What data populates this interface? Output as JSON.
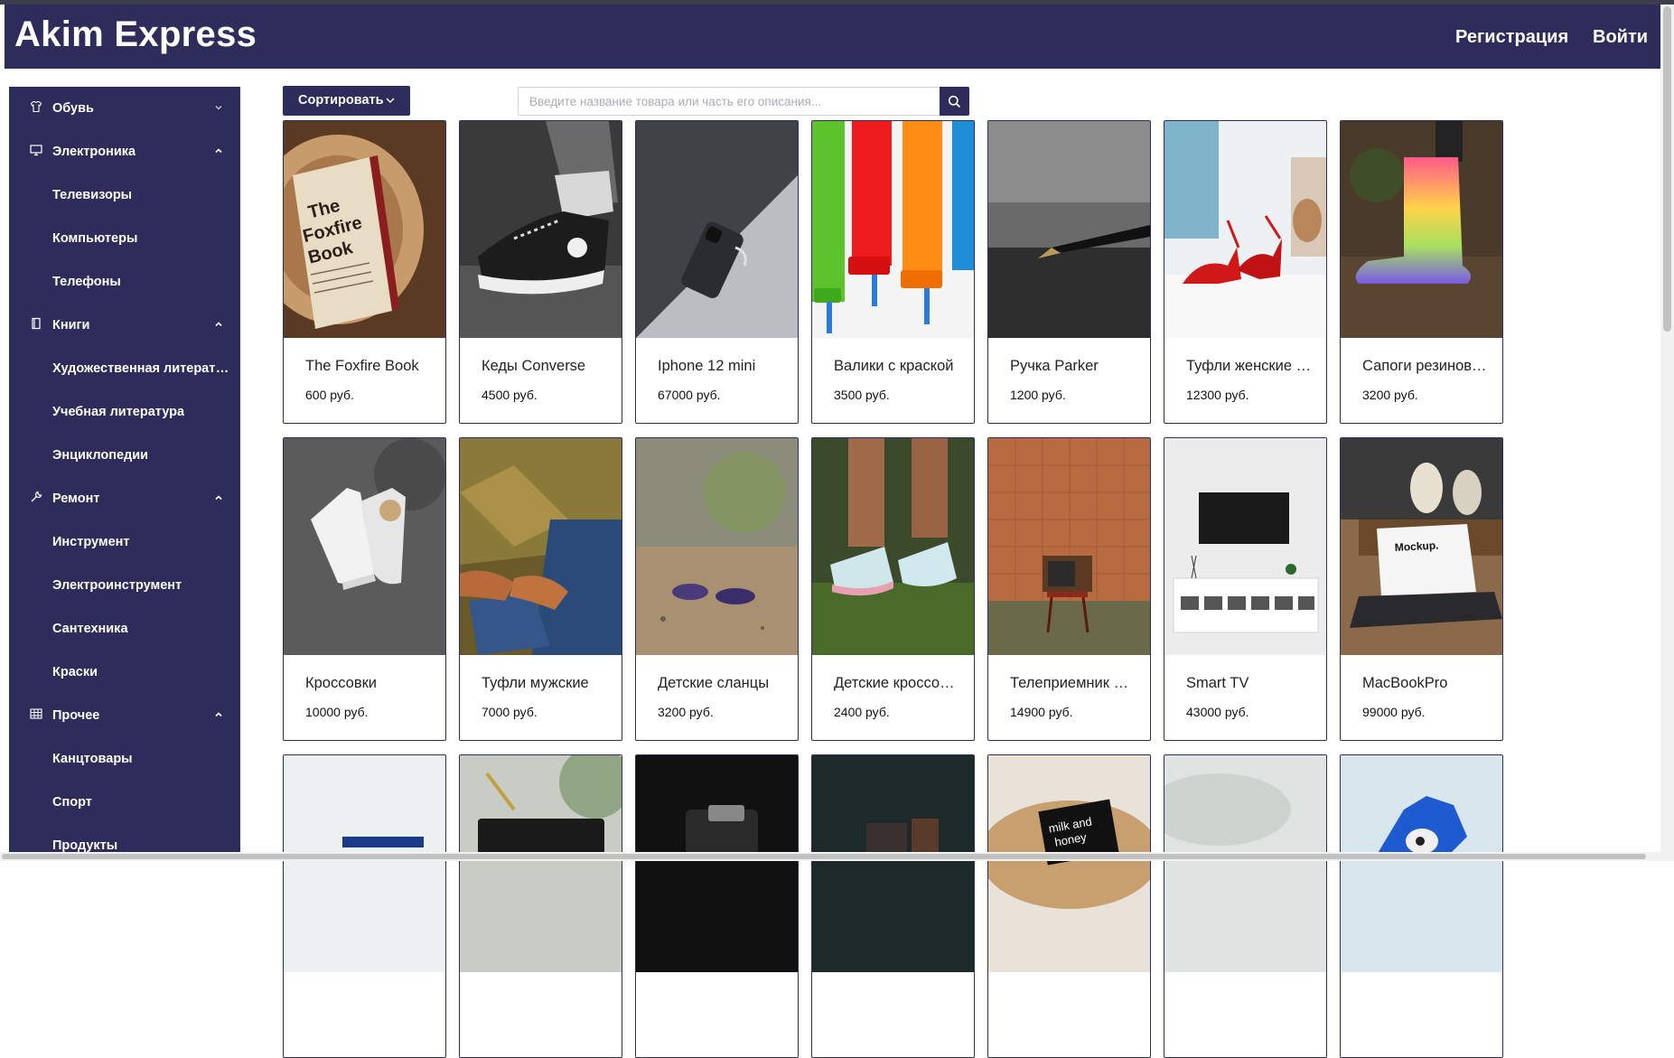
{
  "header": {
    "logo": "Akim Express",
    "register": "Регистрация",
    "login": "Войти"
  },
  "sidebar": {
    "items": [
      {
        "label": "Обувь",
        "icon": "shirt-icon",
        "level": 0,
        "chevron": "down"
      },
      {
        "label": "Электроника",
        "icon": "monitor-icon",
        "level": 0,
        "chevron": "up"
      },
      {
        "label": "Телевизоры",
        "level": 1
      },
      {
        "label": "Компьютеры",
        "level": 1
      },
      {
        "label": "Телефоны",
        "level": 1
      },
      {
        "label": "Книги",
        "icon": "book-icon",
        "level": 0,
        "chevron": "up"
      },
      {
        "label": "Художественная литература",
        "level": 1
      },
      {
        "label": "Учебная литература",
        "level": 1
      },
      {
        "label": "Энциклопедии",
        "level": 1
      },
      {
        "label": "Ремонт",
        "icon": "wrench-icon",
        "level": 0,
        "chevron": "up"
      },
      {
        "label": "Инструмент",
        "level": 1
      },
      {
        "label": "Электроинструмент",
        "level": 1
      },
      {
        "label": "Сантехника",
        "level": 1
      },
      {
        "label": "Краски",
        "level": 1
      },
      {
        "label": "Прочее",
        "icon": "table-icon",
        "level": 0,
        "chevron": "up"
      },
      {
        "label": "Канцтовары",
        "level": 1
      },
      {
        "label": "Спорт",
        "level": 1
      },
      {
        "label": "Продукты",
        "level": 1
      }
    ]
  },
  "toolbar": {
    "sort_label": "Сортировать",
    "search_placeholder": "Введите название товара или часть его описания..."
  },
  "colors": {
    "brand": "#2d2c5a",
    "background": "#ffffff",
    "card_border": "#2d2c5a"
  },
  "products": [
    {
      "name": "The Foxfire Book",
      "price": "600 руб.",
      "image": "foxfire-book-photo"
    },
    {
      "name": "Кеды Converse",
      "price": "4500 руб.",
      "image": "converse-sneaker-photo"
    },
    {
      "name": "Iphone 12 mini",
      "price": "67000 руб.",
      "image": "iphone-photo"
    },
    {
      "name": "Валики с краской",
      "price": "3500 руб.",
      "image": "paint-rollers-photo"
    },
    {
      "name": "Ручка Parker",
      "price": "1200 руб.",
      "image": "pen-photo"
    },
    {
      "name": "Туфли женские красные",
      "price": "12300 руб.",
      "image": "red-heels-photo"
    },
    {
      "name": "Сапоги резиновые",
      "price": "3200 руб.",
      "image": "rain-boots-photo"
    },
    {
      "name": "Кроссовки",
      "price": "10000 руб.",
      "image": "white-sneakers-photo"
    },
    {
      "name": "Туфли мужские",
      "price": "7000 руб.",
      "image": "mens-shoes-photo"
    },
    {
      "name": "Детские сланцы",
      "price": "3200 руб.",
      "image": "kids-slippers-photo"
    },
    {
      "name": "Детские кроссовки",
      "price": "2400 руб.",
      "image": "kids-sneakers-photo"
    },
    {
      "name": "Телеприемник ретро",
      "price": "14900 руб.",
      "image": "retro-tv-photo"
    },
    {
      "name": "Smart TV",
      "price": "43000 руб.",
      "image": "smart-tv-photo"
    },
    {
      "name": "MacBookPro",
      "price": "99000 руб.",
      "image": "macbook-photo"
    },
    {
      "name": "",
      "price": "",
      "image": "laptop-photo"
    },
    {
      "name": "",
      "price": "",
      "image": "tablet-photo"
    },
    {
      "name": "",
      "price": "",
      "image": "camera-photo"
    },
    {
      "name": "",
      "price": "",
      "image": "phone-dark-photo"
    },
    {
      "name": "",
      "price": "",
      "image": "milk-and-honey-book-photo"
    },
    {
      "name": "",
      "price": "",
      "image": "foggy-photo"
    },
    {
      "name": "",
      "price": "",
      "image": "sonic-figure-photo"
    }
  ]
}
